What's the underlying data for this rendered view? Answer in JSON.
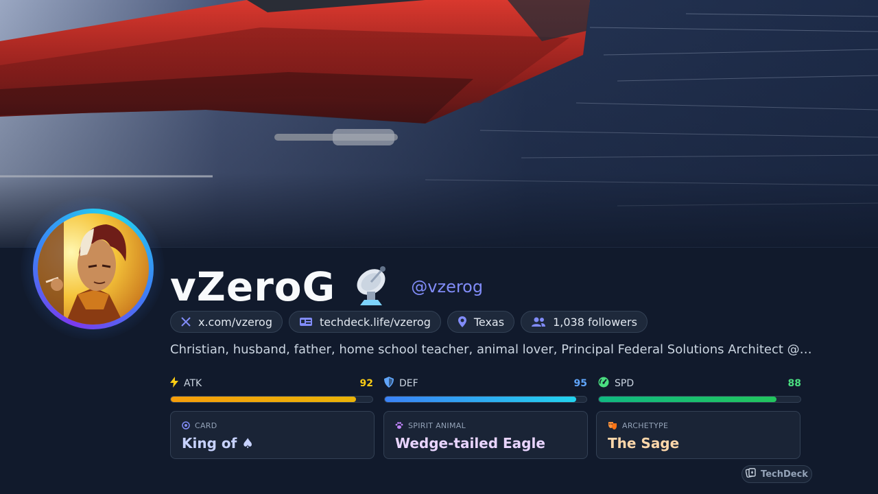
{
  "profile": {
    "display_name": "vZeroG",
    "name_emoji": "📡",
    "handle": "@vzerog",
    "bio": "Christian, husband, father, home school teacher, animal lover, Principal Federal Solutions Architect @VMware b..."
  },
  "chips": [
    {
      "icon": "x-logo-icon",
      "text": "x.com/vzerog"
    },
    {
      "icon": "id-card-icon",
      "text": "techdeck.life/vzerog"
    },
    {
      "icon": "location-pin-icon",
      "text": "Texas"
    },
    {
      "icon": "users-icon",
      "text": "1,038 followers"
    }
  ],
  "stats": [
    {
      "icon": "lightning-icon",
      "label": "ATK",
      "value": "92",
      "level": 92,
      "color": "#facc15",
      "bar_from": "#f59e0b",
      "bar_to": "#eab308"
    },
    {
      "icon": "shield-icon",
      "label": "DEF",
      "value": "95",
      "level": 95,
      "color": "#60a5fa",
      "bar_from": "#3b82f6",
      "bar_to": "#22d3ee"
    },
    {
      "icon": "speedometer-icon",
      "label": "SPD",
      "value": "88",
      "level": 88,
      "color": "#4ade80",
      "bar_from": "#10b981",
      "bar_to": "#22c55e"
    }
  ],
  "cards": [
    {
      "icon": "target-icon",
      "label": "CARD",
      "value": "King of ♠",
      "color": "#c7d2fe",
      "icon_color": "#818cf8"
    },
    {
      "icon": "paw-icon",
      "label": "SPIRIT ANIMAL",
      "value": "Wedge-tailed Eagle",
      "color": "#e9d5ff",
      "icon_color": "#c084fc"
    },
    {
      "icon": "theater-masks-icon",
      "label": "ARCHETYPE",
      "value": "The Sage",
      "color": "#fed7aa",
      "icon_color": "#fb923c"
    }
  ],
  "brand": {
    "icon": "card-deck-icon",
    "label": "TechDeck"
  }
}
